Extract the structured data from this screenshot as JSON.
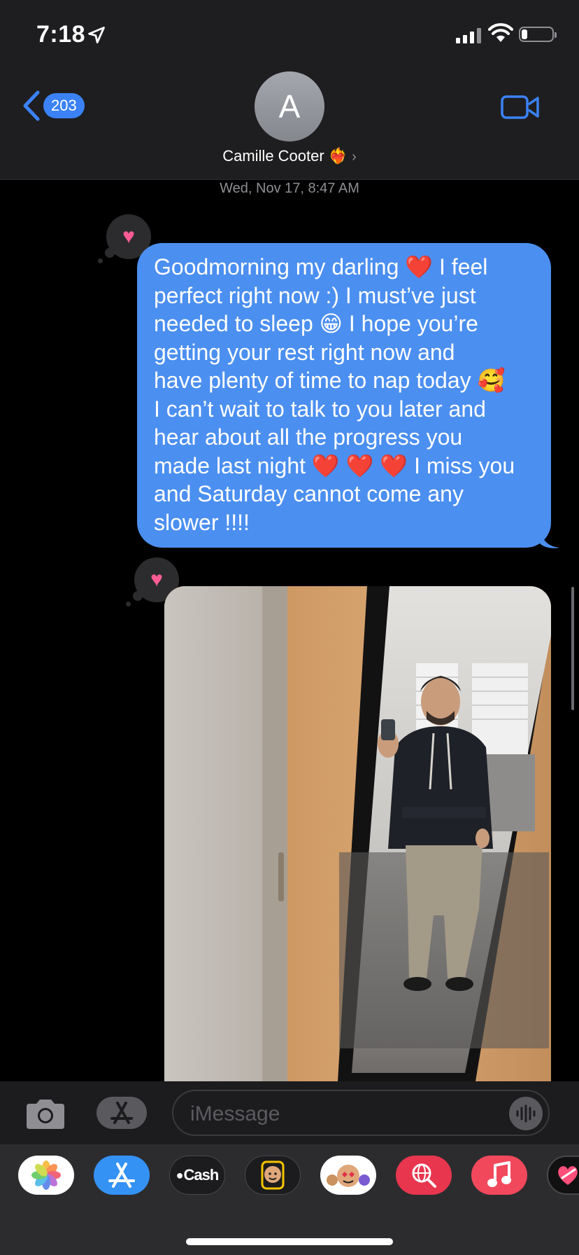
{
  "status_bar": {
    "time": "7:18",
    "battery_level": 0.2
  },
  "header": {
    "back_count": "203",
    "avatar_initial": "A",
    "contact_name": "Camille Cooter",
    "contact_emoji": "❤️‍🔥"
  },
  "conversation": {
    "timestamp": "Wed, Nov 17, 8:47 AM",
    "message_text": "Goodmorning my darling ❤️ I feel perfect right now :) I must’ve just needed to sleep 😁 I hope you’re getting your rest right now and have plenty of time to nap today 🥰 I can’t wait to talk to you later and hear about all the progress you made last night ❤️ ❤️ ❤️ I miss you and Saturday cannot come any slower !!!!",
    "message_lines": [
      "Goodmorning my darling ❤️ I feel",
      "perfect right now :) I must’ve just",
      "needed to sleep 😁 I hope you’re",
      "getting your rest right now and",
      "have plenty of time to nap today 🥰",
      "I can’t wait to talk to you later and",
      "hear about all the progress you",
      "made last night ❤️ ❤️ ❤️ I miss you",
      "and Saturday cannot come any",
      "slower !!!!"
    ],
    "tapback_icon": "♥"
  },
  "compose": {
    "placeholder": "iMessage"
  },
  "app_drawer": {
    "apps": [
      {
        "name": "photos-app",
        "icon": "photos-icon"
      },
      {
        "name": "app-store-app",
        "icon": "app-store-icon"
      },
      {
        "name": "apple-cash-app",
        "label": "Cash",
        "icon": "apple-icon"
      },
      {
        "name": "memoji-app",
        "icon": "memoji-icon"
      },
      {
        "name": "memoji-stickers-app",
        "icon": "memoji-stickers-icon"
      },
      {
        "name": "images-search-app",
        "icon": "globe-search-icon"
      },
      {
        "name": "music-app",
        "icon": "music-note-icon"
      },
      {
        "name": "digital-touch-app",
        "icon": "heart-touch-icon"
      }
    ]
  },
  "colors": {
    "accent": "#3b82f6",
    "bubble": "#4b8ff0",
    "tapback_heart": "#ff5c93"
  }
}
